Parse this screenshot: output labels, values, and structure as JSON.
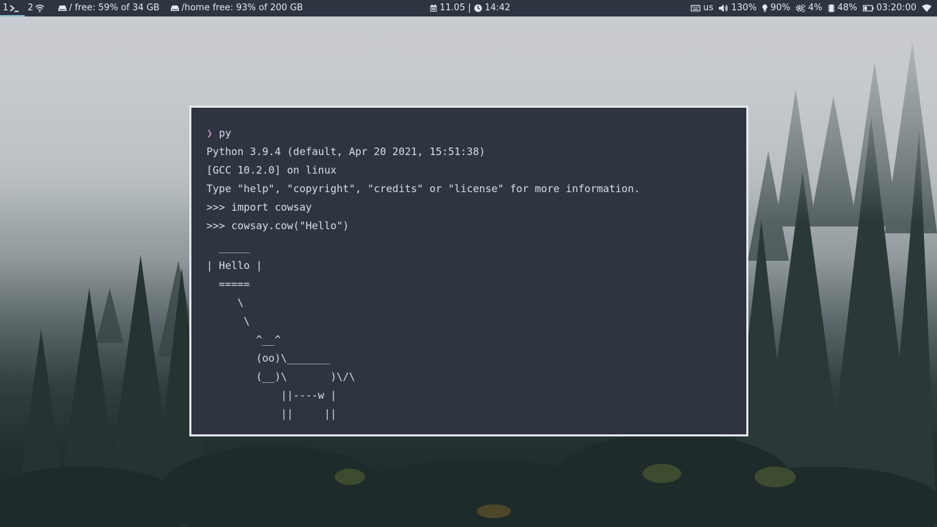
{
  "topbar": {
    "workspaces": [
      {
        "label": "1",
        "icon": "terminal-icon",
        "active": true
      },
      {
        "label": "2",
        "icon": "wifi-icon",
        "active": false
      }
    ],
    "disk_root": "/ free: 59% of 34 GB",
    "disk_home": "/home free: 93% of 200 GB",
    "date": "11.05",
    "time": "14:42",
    "keyboard_layout": "us",
    "volume": "130%",
    "brightness": "90%",
    "cpu": "4%",
    "memory": "48%",
    "battery_time": "03:20:00"
  },
  "terminal": {
    "prompt_symbol": "❯",
    "lines": [
      "py",
      "Python 3.9.4 (default, Apr 20 2021, 15:51:38)",
      "[GCC 10.2.0] on linux",
      "Type \"help\", \"copyright\", \"credits\" or \"license\" for more information.",
      ">>> import cowsay",
      ">>> cowsay.cow(\"Hello\")"
    ],
    "cow_lines": [
      "  _____",
      "| Hello |",
      "  =====",
      "     \\",
      "      \\",
      "        ^__^",
      "        (oo)\\_______",
      "        (__)\\       )\\/\\",
      "            ||----w |",
      "            ||     ||"
    ]
  },
  "colors": {
    "bar_bg": "#2e3440",
    "terminal_bg": "#2e3440",
    "terminal_border": "#e5e9f0",
    "prompt_accent": "#b48ead",
    "workspace_indicator": "#88c0d0"
  }
}
